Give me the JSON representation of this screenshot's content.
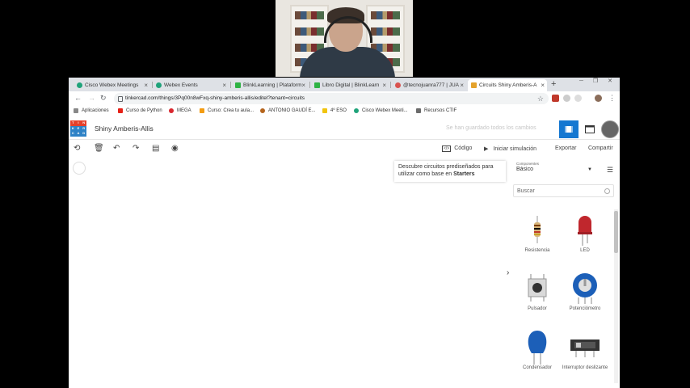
{
  "browser": {
    "tabs": [
      {
        "label": "Cisco Webex Meetings",
        "fav_color": "#1fa37a"
      },
      {
        "label": "Webex Events",
        "fav_color": "#1fa37a"
      },
      {
        "label": "BlinkLearning | Plataform",
        "fav_color": "#2fb344"
      },
      {
        "label": "Libro Digital | BlinkLearn",
        "fav_color": "#2fb344"
      },
      {
        "label": "@tecnojuanra777 | JUA",
        "fav_color": "#d9534f"
      },
      {
        "label": "Circuits Shiny Amberis-A",
        "fav_color": "#e4a22b"
      }
    ],
    "url": "tinkercad.com/things/3Pq00n8wFxq-shiny-amberis-allis/editel?tenant=circuits",
    "bookmarks": [
      {
        "label": "Aplicaciones",
        "color": "#888888"
      },
      {
        "label": "Curso de Python",
        "color": "#e62117"
      },
      {
        "label": "MEGA",
        "color": "#d9272e"
      },
      {
        "label": "Curso: Crea tu aula...",
        "color": "#f39c12"
      },
      {
        "label": "ANTONIO GAUDÍ E...",
        "color": "#b5651d"
      },
      {
        "label": "4º ESO",
        "color": "#f1c40f"
      },
      {
        "label": "Cisco Webex Meeti...",
        "color": "#1fa37a"
      },
      {
        "label": "Recursos CTIF",
        "color": "#6b6b6b"
      }
    ]
  },
  "app": {
    "logo_letters": [
      "TIN",
      "KER",
      "CAD"
    ],
    "design_title": "Shiny Amberis-Allis",
    "saved_status": "Se han guardado todos los cambios",
    "toolbar": {
      "code_label": "Código",
      "simulate_label": "Iniciar simulación",
      "export_label": "Exportar",
      "share_label": "Compartir"
    },
    "starters_tip_line1": "Descubre circuitos prediseñados para",
    "starters_tip_line2_prefix": "utilizar como base en ",
    "starters_tip_line2_bold": "Starters"
  },
  "panel": {
    "components_label": "Componentes",
    "selected_category": "Básico",
    "search_placeholder": "Buscar",
    "items": [
      {
        "label": "Resistencia",
        "icon": "resistor-icon"
      },
      {
        "label": "LED",
        "icon": "led-icon"
      },
      {
        "label": "Pulsador",
        "icon": "pushbutton-icon"
      },
      {
        "label": "Potenciómetro",
        "icon": "potentiometer-icon"
      },
      {
        "label": "Condensador",
        "icon": "capacitor-icon"
      },
      {
        "label": "Interruptor deslizante",
        "icon": "slide-switch-icon"
      }
    ]
  },
  "colors": {
    "accent": "#1477d1",
    "led_red": "#c0272d",
    "capacitor_blue": "#1c5fb8"
  }
}
